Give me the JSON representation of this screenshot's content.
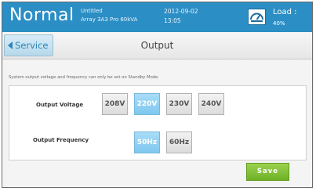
{
  "status_bar": {
    "mode": "Normal",
    "file_name": "Untitled",
    "model": "Array 3A3 Pro 60kVA",
    "date": "2012-09-02",
    "time": "13:05",
    "load_label": "Load :",
    "load_value": "40%",
    "background_color": "#2b8ec4",
    "load_icon": "gauge-icon"
  },
  "title_bar": {
    "back_label": "Service",
    "back_icon": "arrow-left-icon",
    "title": "Output"
  },
  "notice": "System output voltage and frequency can only be set on Standby Mode.",
  "settings": {
    "voltage": {
      "label": "Output Voltage",
      "options": [
        "208V",
        "220V",
        "230V",
        "240V"
      ],
      "selected": "220V"
    },
    "frequency": {
      "label": "Output Frequency",
      "options": [
        "50Hz",
        "60Hz"
      ],
      "selected": "50Hz"
    }
  },
  "save_label": "Save",
  "colors": {
    "selected": "#7ec8ef",
    "save": "#7bbf2f"
  }
}
